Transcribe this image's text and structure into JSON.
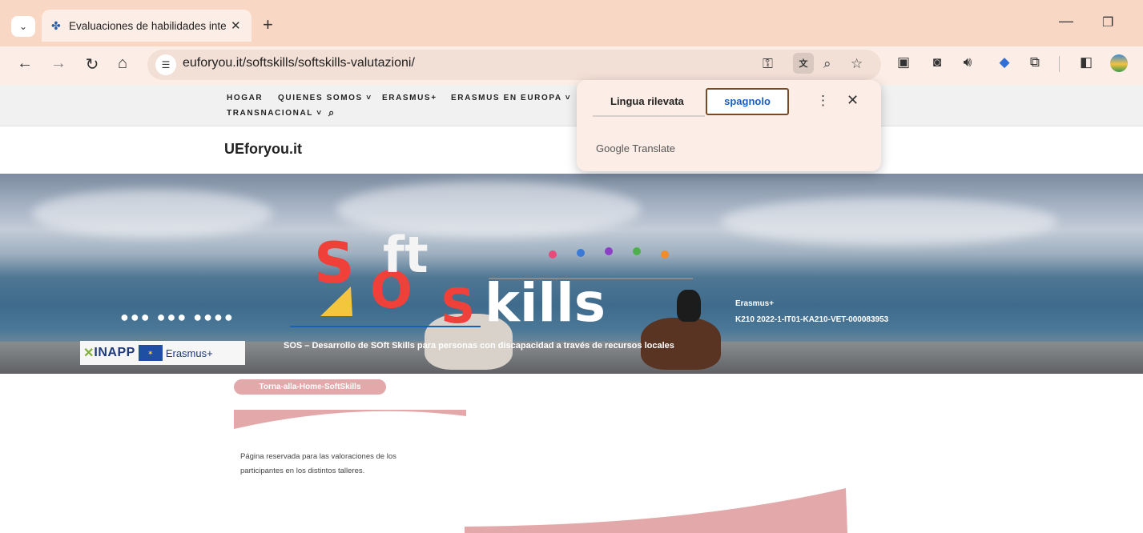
{
  "browser": {
    "tab_title": "Evaluaciones de habilidades inte",
    "tab_close": "✕",
    "new_tab": "+",
    "url": "euforyou.it/softskills/softskills-valutazioni/"
  },
  "site": {
    "nav": [
      {
        "label": "HOGAR"
      },
      {
        "label": "QUIENES SOMOS ˅"
      },
      {
        "label": "ERASMUS+"
      },
      {
        "label": "ERASMUS EN EUROPA ˅"
      },
      {
        "label": "TRANSNACIONAL ˅"
      }
    ],
    "title": "UEforyou.it"
  },
  "hero": {
    "logo_text": [
      "S",
      "O",
      "ft",
      "S",
      "kills"
    ],
    "slider_dots": "●●● ●●● ●●●●",
    "project_line1": "Erasmus+",
    "project_line2": "K210 2022-1-IT01-KA210-VET-000083953",
    "tagline": "SOS – Desarrollo de SOft Skills para personas con discapacidad a través de recursos locales",
    "sponsor_inapp": "INAPP",
    "sponsor_erasmus": "Erasmus+"
  },
  "content": {
    "home_button": "Torna-alla-Home-SoftSkills",
    "text": "Página reservada para las valoraciones de los participantes en los distintos talleres."
  },
  "translate_popup": {
    "detected_label": "Lingua rilevata",
    "selected_language": "spagnolo",
    "brand": "Google Translate"
  },
  "colors": {
    "chrome_tabstrip": "#f9d7c5",
    "chrome_toolbar": "#fceee6",
    "accent_pink": "#e3a8aa",
    "logo_red": "#f0403a"
  }
}
